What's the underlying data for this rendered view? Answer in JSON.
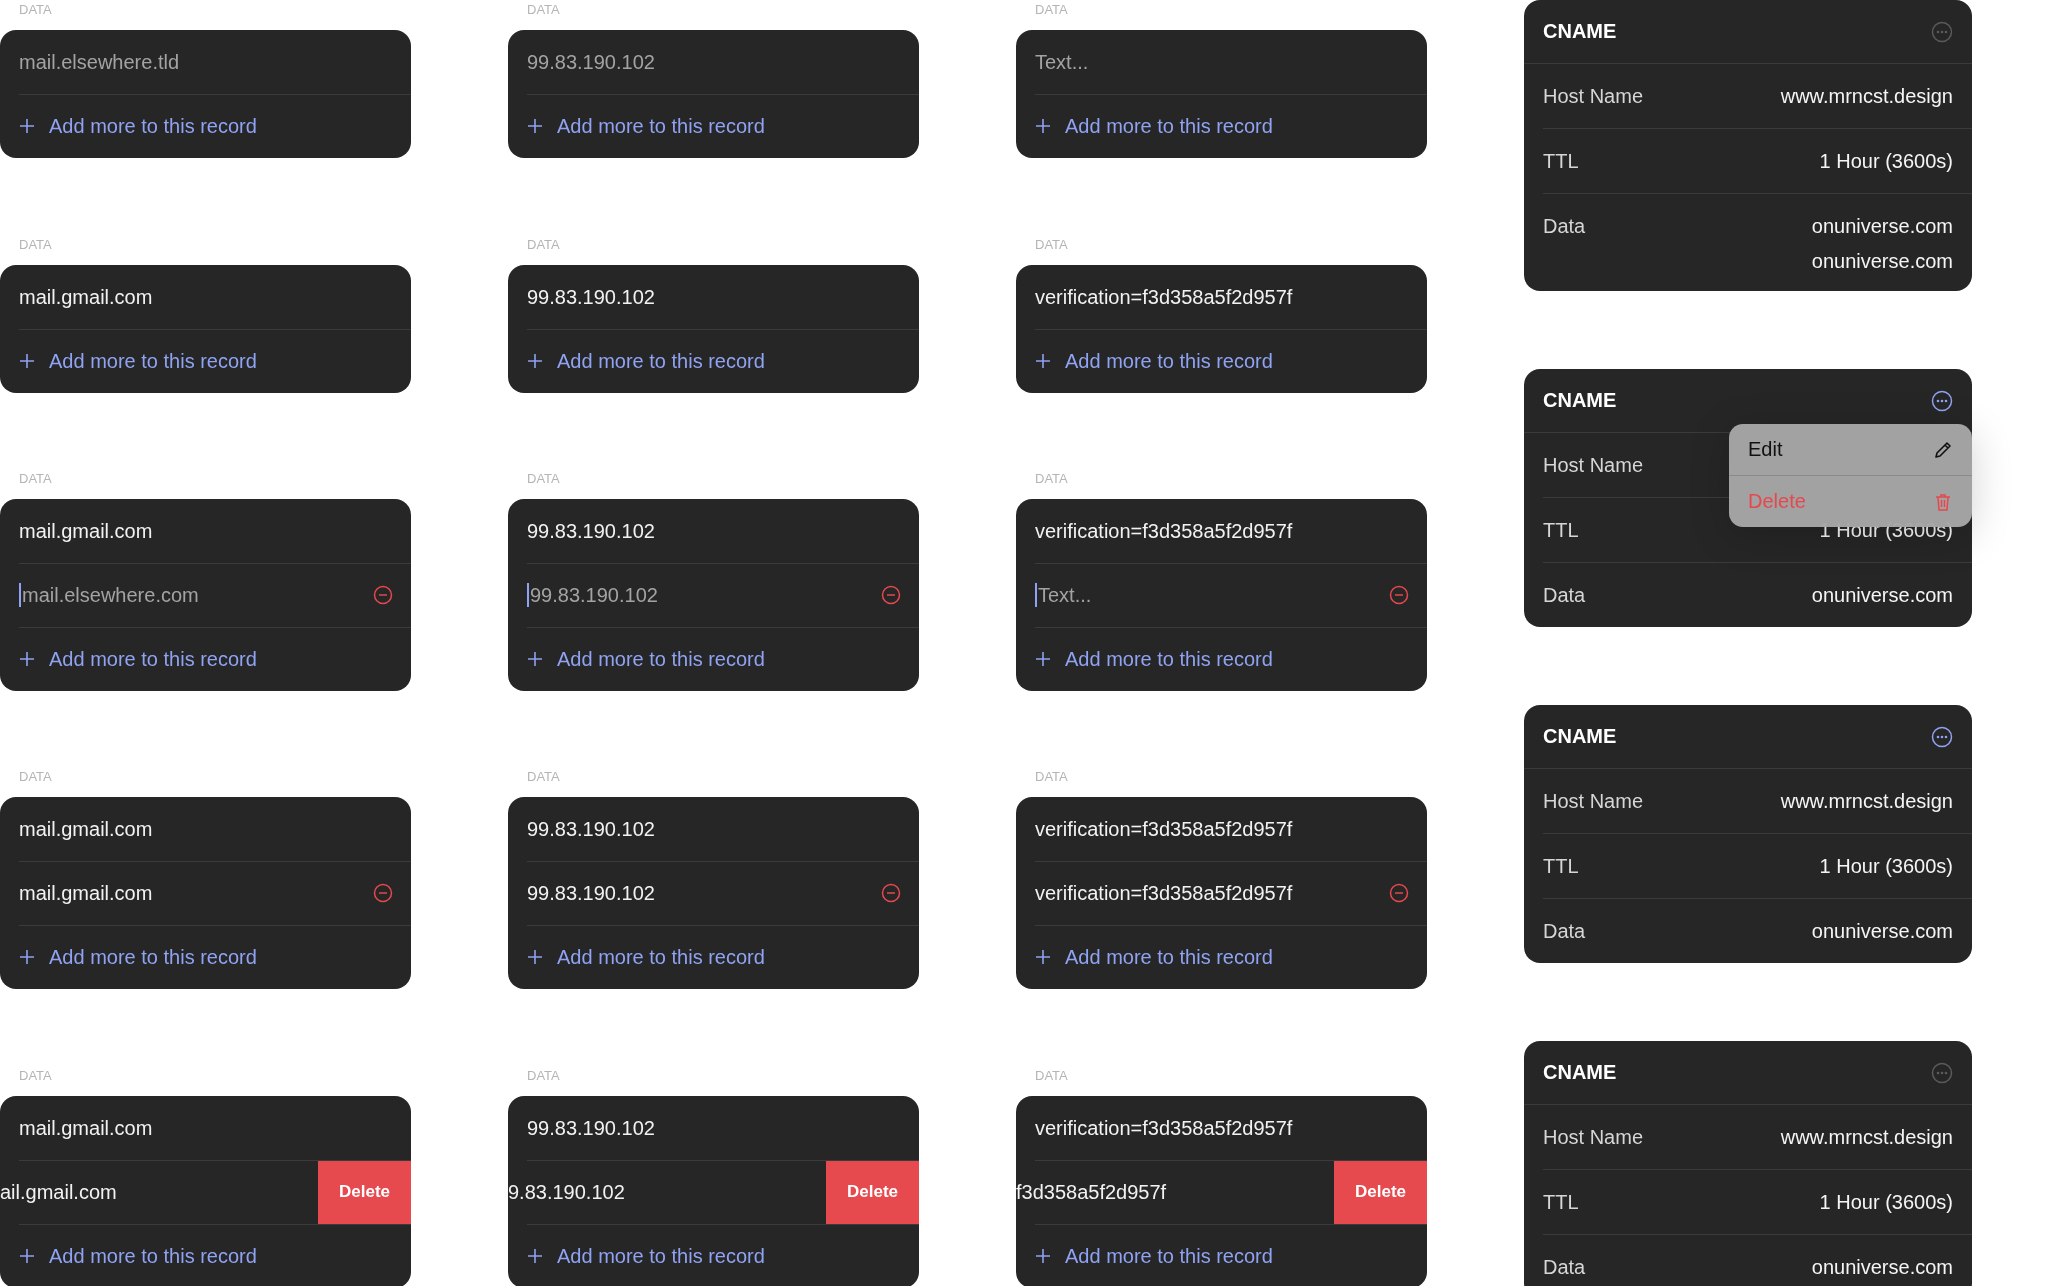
{
  "editor_rows": [
    [
      {
        "label": "DATA",
        "add_label": "Add more to this record",
        "entries": [
          {
            "kind": "placeholder",
            "text": "mail.elsewhere.tld",
            "focused": false,
            "removable": false,
            "swiped": false
          }
        ]
      },
      {
        "label": "DATA",
        "add_label": "Add more to this record",
        "entries": [
          {
            "kind": "placeholder",
            "text": "99.83.190.102",
            "focused": false,
            "removable": false,
            "swiped": false
          }
        ]
      },
      {
        "label": "DATA",
        "add_label": "Add more to this record",
        "entries": [
          {
            "kind": "placeholder",
            "text": "Text...",
            "focused": false,
            "removable": false,
            "swiped": false
          }
        ]
      }
    ],
    [
      {
        "label": "DATA",
        "add_label": "Add more to this record",
        "entries": [
          {
            "kind": "value",
            "text": "mail.gmail.com",
            "focused": false,
            "removable": false,
            "swiped": false
          }
        ]
      },
      {
        "label": "DATA",
        "add_label": "Add more to this record",
        "entries": [
          {
            "kind": "value",
            "text": "99.83.190.102",
            "focused": false,
            "removable": false,
            "swiped": false
          }
        ]
      },
      {
        "label": "DATA",
        "add_label": "Add more to this record",
        "entries": [
          {
            "kind": "value",
            "text": "verification=f3d358a5f2d957f",
            "focused": false,
            "removable": false,
            "swiped": false
          }
        ]
      }
    ],
    [
      {
        "label": "DATA",
        "add_label": "Add more to this record",
        "entries": [
          {
            "kind": "value",
            "text": "mail.gmail.com",
            "focused": false,
            "removable": false,
            "swiped": false
          },
          {
            "kind": "placeholder",
            "text": "mail.elsewhere.com",
            "focused": true,
            "removable": true,
            "swiped": false
          }
        ]
      },
      {
        "label": "DATA",
        "add_label": "Add more to this record",
        "entries": [
          {
            "kind": "value",
            "text": "99.83.190.102",
            "focused": false,
            "removable": false,
            "swiped": false
          },
          {
            "kind": "placeholder",
            "text": "99.83.190.102",
            "focused": true,
            "removable": true,
            "swiped": false
          }
        ]
      },
      {
        "label": "DATA",
        "add_label": "Add more to this record",
        "entries": [
          {
            "kind": "value",
            "text": "verification=f3d358a5f2d957f",
            "focused": false,
            "removable": false,
            "swiped": false
          },
          {
            "kind": "placeholder",
            "text": "Text...",
            "focused": true,
            "removable": true,
            "swiped": false
          }
        ]
      }
    ],
    [
      {
        "label": "DATA",
        "add_label": "Add more to this record",
        "entries": [
          {
            "kind": "value",
            "text": "mail.gmail.com",
            "focused": false,
            "removable": false,
            "swiped": false
          },
          {
            "kind": "value",
            "text": "mail.gmail.com",
            "focused": false,
            "removable": true,
            "swiped": false
          }
        ]
      },
      {
        "label": "DATA",
        "add_label": "Add more to this record",
        "entries": [
          {
            "kind": "value",
            "text": "99.83.190.102",
            "focused": false,
            "removable": false,
            "swiped": false
          },
          {
            "kind": "value",
            "text": "99.83.190.102",
            "focused": false,
            "removable": true,
            "swiped": false
          }
        ]
      },
      {
        "label": "DATA",
        "add_label": "Add more to this record",
        "entries": [
          {
            "kind": "value",
            "text": "verification=f3d358a5f2d957f",
            "focused": false,
            "removable": false,
            "swiped": false
          },
          {
            "kind": "value",
            "text": "verification=f3d358a5f2d957f",
            "focused": false,
            "removable": true,
            "swiped": false
          }
        ]
      }
    ],
    [
      {
        "label": "DATA",
        "add_label": "Add more to this record",
        "entries": [
          {
            "kind": "value",
            "text": "mail.gmail.com",
            "focused": false,
            "removable": false,
            "swiped": false
          },
          {
            "kind": "value",
            "text": "ail.gmail.com",
            "focused": false,
            "removable": false,
            "swiped": true,
            "delete_label": "Delete"
          }
        ]
      },
      {
        "label": "DATA",
        "add_label": "Add more to this record",
        "entries": [
          {
            "kind": "value",
            "text": "99.83.190.102",
            "focused": false,
            "removable": false,
            "swiped": false
          },
          {
            "kind": "value",
            "text": "9.83.190.102",
            "focused": false,
            "removable": false,
            "swiped": true,
            "delete_label": "Delete"
          }
        ]
      },
      {
        "label": "DATA",
        "add_label": "Add more to this record",
        "entries": [
          {
            "kind": "value",
            "text": "verification=f3d358a5f2d957f",
            "focused": false,
            "removable": false,
            "swiped": false
          },
          {
            "kind": "value",
            "text": "f3d358a5f2d957f",
            "focused": false,
            "removable": false,
            "swiped": true,
            "delete_label": "Delete"
          }
        ]
      }
    ]
  ],
  "cname_cards": [
    {
      "title": "CNAME",
      "menu_active": false,
      "rows": [
        {
          "label": "Host Name",
          "values": [
            "www.mrncst.design"
          ]
        },
        {
          "label": "TTL",
          "values": [
            "1 Hour (3600s)"
          ]
        },
        {
          "label": "Data",
          "values": [
            "onuniverse.com",
            "onuniverse.com"
          ]
        }
      ]
    },
    {
      "title": "CNAME",
      "menu_active": true,
      "rows": [
        {
          "label": "Host Name",
          "values": []
        },
        {
          "label": "TTL",
          "values": [
            "1 Hour (3600s)"
          ]
        },
        {
          "label": "Data",
          "values": [
            "onuniverse.com"
          ]
        }
      ],
      "menu": [
        {
          "kind": "edit",
          "label": "Edit"
        },
        {
          "kind": "delete",
          "label": "Delete"
        }
      ]
    },
    {
      "title": "CNAME",
      "menu_active": true,
      "rows": [
        {
          "label": "Host Name",
          "values": [
            "www.mrncst.design"
          ]
        },
        {
          "label": "TTL",
          "values": [
            "1 Hour (3600s)"
          ]
        },
        {
          "label": "Data",
          "values": [
            "onuniverse.com"
          ]
        }
      ]
    },
    {
      "title": "CNAME",
      "menu_active": false,
      "rows": [
        {
          "label": "Host Name",
          "values": [
            "www.mrncst.design"
          ]
        },
        {
          "label": "TTL",
          "values": [
            "1 Hour (3600s)"
          ]
        },
        {
          "label": "Data",
          "values": [
            "onuniverse.com"
          ]
        }
      ]
    }
  ]
}
